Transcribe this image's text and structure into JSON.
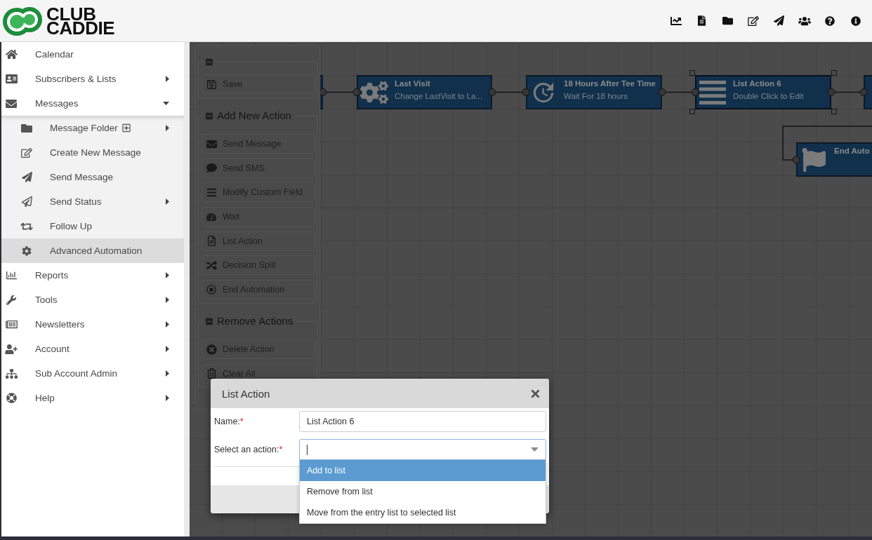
{
  "header": {
    "logo_text": [
      "CLUB",
      "CADDIE"
    ]
  },
  "sidebar": {
    "items": [
      {
        "label": "Calendar",
        "selected": false
      },
      {
        "label": "Subscribers & Lists",
        "selected": false,
        "expanded": false
      },
      {
        "label": "Messages",
        "selected": false,
        "expanded": true,
        "children": [
          {
            "label": "Message Folder",
            "selected": false,
            "expanded": false
          },
          {
            "label": "Create New Message",
            "selected": false
          },
          {
            "label": "Send Message",
            "selected": false
          },
          {
            "label": "Send Status",
            "selected": false,
            "expanded": false
          },
          {
            "label": "Follow Up",
            "selected": false
          },
          {
            "label": "Advanced Automation",
            "selected": true
          }
        ]
      },
      {
        "label": "Reports",
        "selected": false,
        "expanded": false
      },
      {
        "label": "Tools",
        "selected": false,
        "expanded": false
      },
      {
        "label": "Newsletters",
        "selected": false,
        "expanded": false
      },
      {
        "label": "Account",
        "selected": false,
        "expanded": false
      },
      {
        "label": "Sub Account Admin",
        "selected": false,
        "expanded": false
      },
      {
        "label": "Help",
        "selected": false,
        "expanded": false
      }
    ]
  },
  "action_panel": {
    "groups": [
      {
        "expanded": true,
        "items": [
          "Save"
        ]
      },
      {
        "title": "Add New Action",
        "expanded": true,
        "items": [
          "Send Message",
          "Send SMS",
          "Modify Custom Field",
          "Wait",
          "List Action",
          "Decision Split",
          "End Automation"
        ]
      },
      {
        "title": "Remove Actions",
        "expanded": true,
        "items": [
          "Delete Action",
          "Clear All"
        ]
      }
    ]
  },
  "canvas": {
    "nodes": [
      {
        "kind": "custom_field",
        "title": "Last Visit",
        "subtitle": "Change LastVisit to La...",
        "selected": false
      },
      {
        "kind": "wait",
        "title": "18 Hours After Tee Time",
        "subtitle": "Wait For 18 hours",
        "selected": false
      },
      {
        "kind": "list_action",
        "title": "List Action 6",
        "subtitle": "Double Click to Edit",
        "selected": true
      },
      {
        "kind": "end",
        "title": "End Auto",
        "selected": false
      }
    ]
  },
  "dialog": {
    "title": "List Action",
    "fields": [
      {
        "kind": "text",
        "label": "Name:",
        "required_mark": "*",
        "value": "List Action 6"
      },
      {
        "kind": "select",
        "label": "Select an action:",
        "required_mark": "*",
        "expanded": true,
        "options": [
          {
            "label": "Add to list",
            "selected": true
          },
          {
            "label": "Remove from list",
            "selected": false
          },
          {
            "label": "Move from the entry list to selected list",
            "selected": false
          }
        ]
      }
    ]
  }
}
